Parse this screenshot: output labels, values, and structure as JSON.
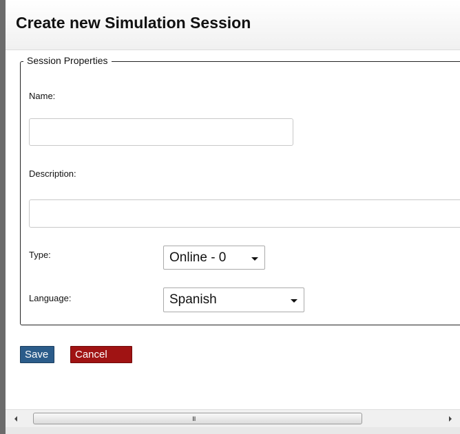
{
  "dialog": {
    "title": "Create new Simulation Session"
  },
  "form": {
    "legend": "Session Properties",
    "name": {
      "label": "Name:",
      "value": "",
      "placeholder": ""
    },
    "description": {
      "label": "Description:",
      "value": "",
      "placeholder": ""
    },
    "type": {
      "label": "Type:",
      "selected": "Online - 0"
    },
    "language": {
      "label": "Language:",
      "selected": "Spanish"
    }
  },
  "actions": {
    "save_label": "Save",
    "cancel_label": "Cancel"
  },
  "scrollbar": {
    "grip": "III"
  },
  "colors": {
    "save_button": "#2b5c8a",
    "cancel_button": "#a01313",
    "fieldset_border": "#222222"
  },
  "icons": {
    "select_arrow": "triangle-down",
    "scroll_left": "triangle-left",
    "scroll_right": "triangle-right"
  }
}
